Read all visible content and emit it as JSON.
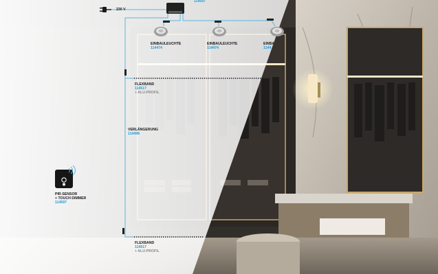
{
  "colors": {
    "wire": "#5ab4e0",
    "code": "#1e9ad6",
    "label": "#1a1a1a",
    "accessory": "#8a8a8a"
  },
  "power": {
    "voltage": "230 V",
    "code_partial": "114597",
    "plug_icon": "power-plug-icon"
  },
  "downlights": [
    {
      "name": "EINBAULEUCHTE",
      "code": "114474"
    },
    {
      "name": "EINBAULEUCHTE",
      "code": "114474"
    },
    {
      "name": "EINBA",
      "code": "1144"
    }
  ],
  "flexbands": [
    {
      "name": "FLEXBAND",
      "code": "114517",
      "accessory": "+ ALU-PROFIL"
    },
    {
      "name": "FLEXBAND",
      "code": "114517",
      "accessory": "+ ALU-PROFIL"
    }
  ],
  "extension": {
    "name": "VERLÄNGERUNG",
    "code": "114498"
  },
  "sensor": {
    "line1": "PIR-SENSOR",
    "line2": "+ TOUCH DIMMER",
    "code": "114597",
    "icon": "pir-sensor-icon"
  }
}
